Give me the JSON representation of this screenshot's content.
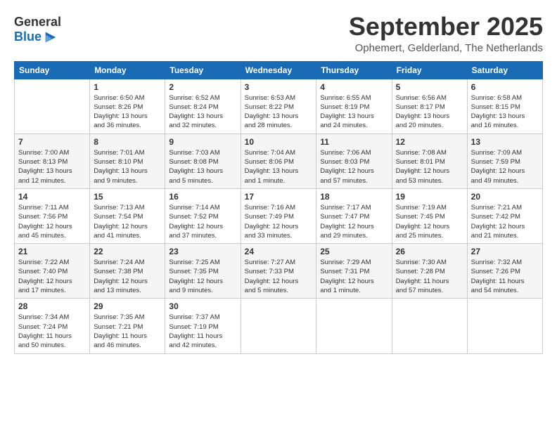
{
  "logo": {
    "general": "General",
    "blue": "Blue"
  },
  "title": "September 2025",
  "subtitle": "Ophemert, Gelderland, The Netherlands",
  "days_of_week": [
    "Sunday",
    "Monday",
    "Tuesday",
    "Wednesday",
    "Thursday",
    "Friday",
    "Saturday"
  ],
  "weeks": [
    [
      {
        "day": "",
        "info": ""
      },
      {
        "day": "1",
        "info": "Sunrise: 6:50 AM\nSunset: 8:26 PM\nDaylight: 13 hours\nand 36 minutes."
      },
      {
        "day": "2",
        "info": "Sunrise: 6:52 AM\nSunset: 8:24 PM\nDaylight: 13 hours\nand 32 minutes."
      },
      {
        "day": "3",
        "info": "Sunrise: 6:53 AM\nSunset: 8:22 PM\nDaylight: 13 hours\nand 28 minutes."
      },
      {
        "day": "4",
        "info": "Sunrise: 6:55 AM\nSunset: 8:19 PM\nDaylight: 13 hours\nand 24 minutes."
      },
      {
        "day": "5",
        "info": "Sunrise: 6:56 AM\nSunset: 8:17 PM\nDaylight: 13 hours\nand 20 minutes."
      },
      {
        "day": "6",
        "info": "Sunrise: 6:58 AM\nSunset: 8:15 PM\nDaylight: 13 hours\nand 16 minutes."
      }
    ],
    [
      {
        "day": "7",
        "info": "Sunrise: 7:00 AM\nSunset: 8:13 PM\nDaylight: 13 hours\nand 12 minutes."
      },
      {
        "day": "8",
        "info": "Sunrise: 7:01 AM\nSunset: 8:10 PM\nDaylight: 13 hours\nand 9 minutes."
      },
      {
        "day": "9",
        "info": "Sunrise: 7:03 AM\nSunset: 8:08 PM\nDaylight: 13 hours\nand 5 minutes."
      },
      {
        "day": "10",
        "info": "Sunrise: 7:04 AM\nSunset: 8:06 PM\nDaylight: 13 hours\nand 1 minute."
      },
      {
        "day": "11",
        "info": "Sunrise: 7:06 AM\nSunset: 8:03 PM\nDaylight: 12 hours\nand 57 minutes."
      },
      {
        "day": "12",
        "info": "Sunrise: 7:08 AM\nSunset: 8:01 PM\nDaylight: 12 hours\nand 53 minutes."
      },
      {
        "day": "13",
        "info": "Sunrise: 7:09 AM\nSunset: 7:59 PM\nDaylight: 12 hours\nand 49 minutes."
      }
    ],
    [
      {
        "day": "14",
        "info": "Sunrise: 7:11 AM\nSunset: 7:56 PM\nDaylight: 12 hours\nand 45 minutes."
      },
      {
        "day": "15",
        "info": "Sunrise: 7:13 AM\nSunset: 7:54 PM\nDaylight: 12 hours\nand 41 minutes."
      },
      {
        "day": "16",
        "info": "Sunrise: 7:14 AM\nSunset: 7:52 PM\nDaylight: 12 hours\nand 37 minutes."
      },
      {
        "day": "17",
        "info": "Sunrise: 7:16 AM\nSunset: 7:49 PM\nDaylight: 12 hours\nand 33 minutes."
      },
      {
        "day": "18",
        "info": "Sunrise: 7:17 AM\nSunset: 7:47 PM\nDaylight: 12 hours\nand 29 minutes."
      },
      {
        "day": "19",
        "info": "Sunrise: 7:19 AM\nSunset: 7:45 PM\nDaylight: 12 hours\nand 25 minutes."
      },
      {
        "day": "20",
        "info": "Sunrise: 7:21 AM\nSunset: 7:42 PM\nDaylight: 12 hours\nand 21 minutes."
      }
    ],
    [
      {
        "day": "21",
        "info": "Sunrise: 7:22 AM\nSunset: 7:40 PM\nDaylight: 12 hours\nand 17 minutes."
      },
      {
        "day": "22",
        "info": "Sunrise: 7:24 AM\nSunset: 7:38 PM\nDaylight: 12 hours\nand 13 minutes."
      },
      {
        "day": "23",
        "info": "Sunrise: 7:25 AM\nSunset: 7:35 PM\nDaylight: 12 hours\nand 9 minutes."
      },
      {
        "day": "24",
        "info": "Sunrise: 7:27 AM\nSunset: 7:33 PM\nDaylight: 12 hours\nand 5 minutes."
      },
      {
        "day": "25",
        "info": "Sunrise: 7:29 AM\nSunset: 7:31 PM\nDaylight: 12 hours\nand 1 minute."
      },
      {
        "day": "26",
        "info": "Sunrise: 7:30 AM\nSunset: 7:28 PM\nDaylight: 11 hours\nand 57 minutes."
      },
      {
        "day": "27",
        "info": "Sunrise: 7:32 AM\nSunset: 7:26 PM\nDaylight: 11 hours\nand 54 minutes."
      }
    ],
    [
      {
        "day": "28",
        "info": "Sunrise: 7:34 AM\nSunset: 7:24 PM\nDaylight: 11 hours\nand 50 minutes."
      },
      {
        "day": "29",
        "info": "Sunrise: 7:35 AM\nSunset: 7:21 PM\nDaylight: 11 hours\nand 46 minutes."
      },
      {
        "day": "30",
        "info": "Sunrise: 7:37 AM\nSunset: 7:19 PM\nDaylight: 11 hours\nand 42 minutes."
      },
      {
        "day": "",
        "info": ""
      },
      {
        "day": "",
        "info": ""
      },
      {
        "day": "",
        "info": ""
      },
      {
        "day": "",
        "info": ""
      }
    ]
  ]
}
